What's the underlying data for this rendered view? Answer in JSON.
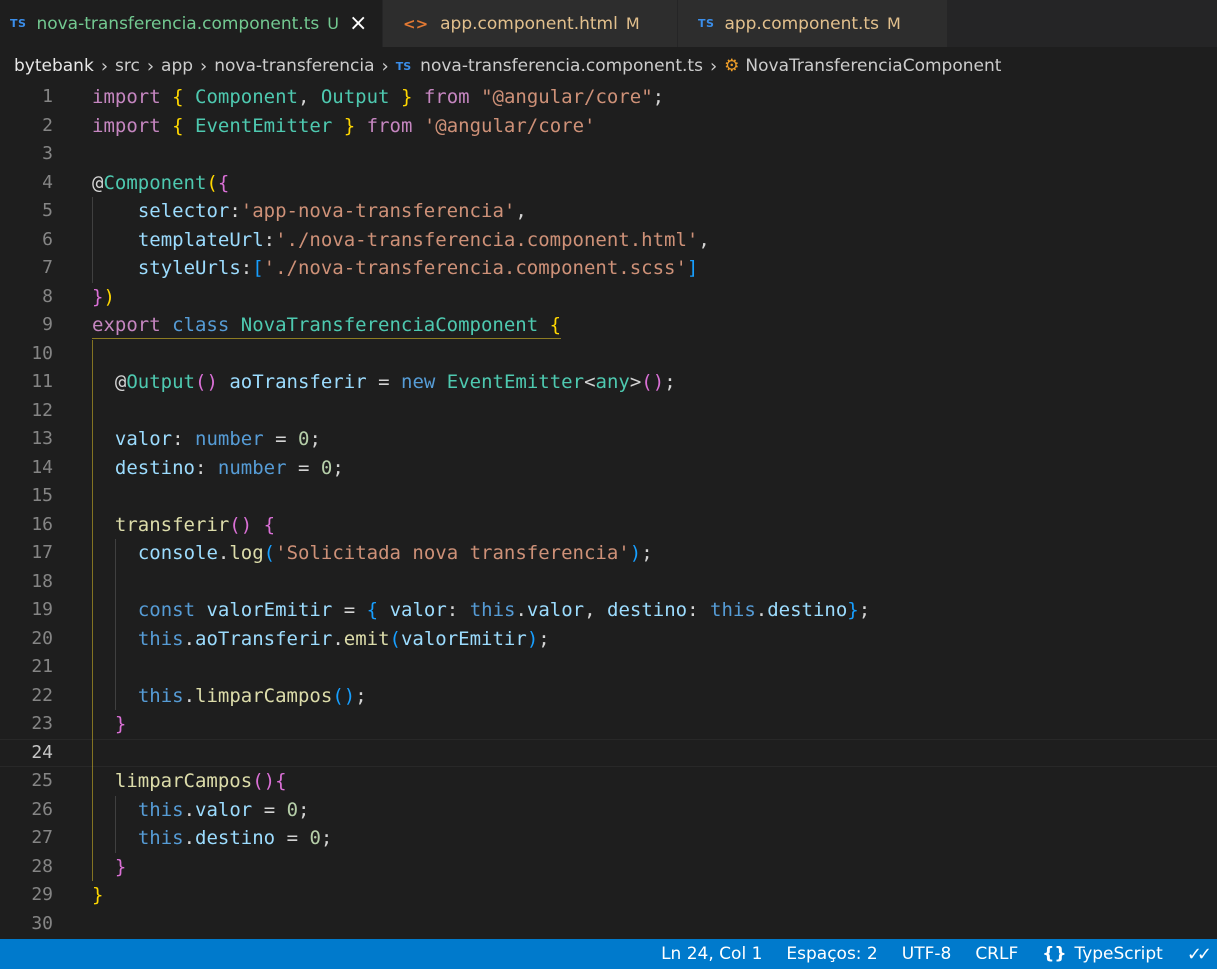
{
  "tabs": [
    {
      "badge": "TS",
      "name": "nova-transferencia.component.ts",
      "status": "U",
      "active": true
    },
    {
      "badge": "<>",
      "name": "app.component.html",
      "status": "M",
      "active": false
    },
    {
      "badge": "TS",
      "name": "app.component.ts",
      "status": "M",
      "active": false
    }
  ],
  "breadcrumb": {
    "items": [
      "bytebank",
      "src",
      "app",
      "nova-transferencia"
    ],
    "file_badge": "TS",
    "file": "nova-transferencia.component.ts",
    "symbol": "NovaTransferenciaComponent"
  },
  "editor": {
    "current_line": 24,
    "lines": [
      "import { Component, Output } from \"@angular/core\";",
      "import { EventEmitter } from '@angular/core'",
      "",
      "@Component({",
      "    selector:'app-nova-transferencia',",
      "    templateUrl:'./nova-transferencia.component.html',",
      "    styleUrls:['./nova-transferencia.component.scss']",
      "})",
      "export class NovaTransferenciaComponent {",
      "",
      "  @Output() aoTransferir = new EventEmitter<any>();",
      "",
      "  valor: number = 0;",
      "  destino: number = 0;",
      "",
      "  transferir() {",
      "    console.log('Solicitada nova transferencia');",
      "",
      "    const valorEmitir = { valor: this.valor, destino: this.destino};",
      "    this.aoTransferir.emit(valorEmitir);",
      "",
      "    this.limparCampos();",
      "  }",
      "",
      "  limparCampos(){",
      "    this.valor = 0;",
      "    this.destino = 0;",
      "  }",
      "}",
      ""
    ]
  },
  "statusbar": {
    "position": "Ln 24, Col 1",
    "indent": "Espaços: 2",
    "encoding": "UTF-8",
    "eol": "CRLF",
    "language_icon": "{}",
    "language": "TypeScript",
    "notification_icon": "double-check-icon"
  },
  "colors": {
    "editor_bg": "#1e1e1e",
    "statusbar_bg": "#007acc",
    "untracked": "#73c991",
    "modified": "#e2c08d"
  }
}
